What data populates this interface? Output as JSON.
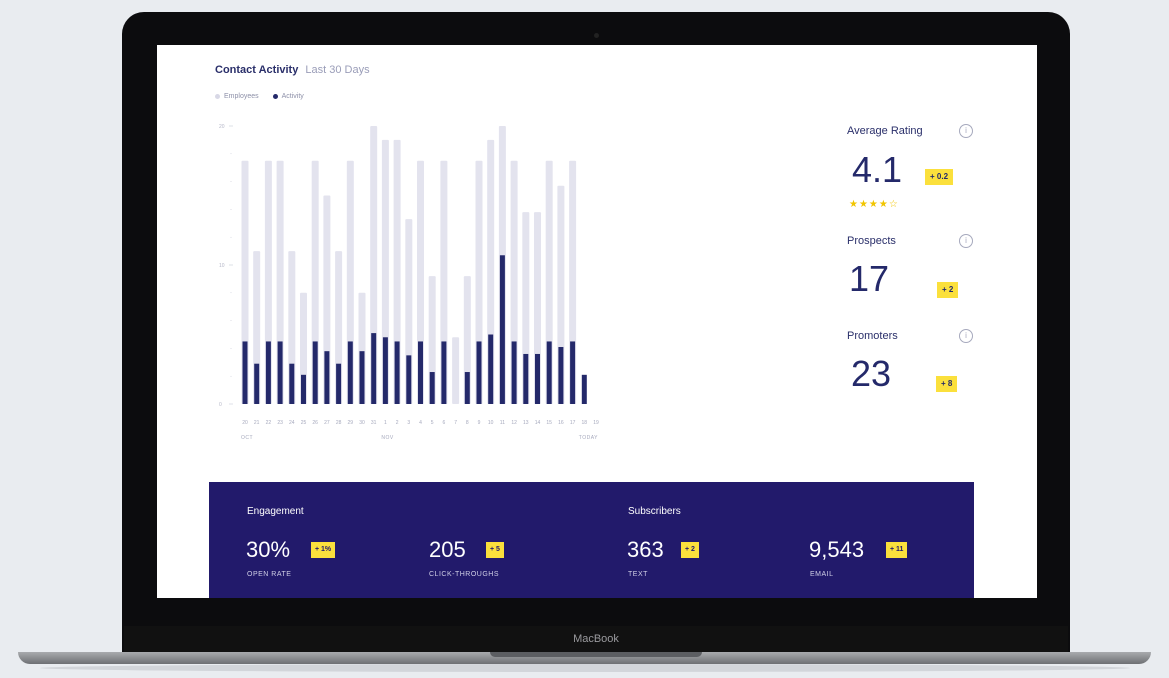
{
  "device": {
    "brand": "MacBook"
  },
  "header": {
    "title": "Contact Activity",
    "subtitle": "Last 30 Days"
  },
  "legend": [
    {
      "label": "Employees",
      "color": "#d8d8e6"
    },
    {
      "label": "Activity",
      "color": "#24296a"
    }
  ],
  "chart_data": {
    "type": "bar",
    "categories": [
      "20",
      "21",
      "22",
      "23",
      "24",
      "25",
      "26",
      "27",
      "28",
      "29",
      "30",
      "31",
      "1",
      "2",
      "3",
      "4",
      "5",
      "6",
      "7",
      "8",
      "9",
      "10",
      "11",
      "12",
      "13",
      "14",
      "15",
      "16",
      "17",
      "18",
      "19"
    ],
    "month_labels": {
      "0": "OCT",
      "12": "NOV",
      "30": "TODAY"
    },
    "y_ticks": [
      "0",
      "10",
      "20"
    ],
    "ylim": [
      0,
      20
    ],
    "series": [
      {
        "name": "Employees",
        "color": "#e3e3ee",
        "values": [
          17.5,
          11,
          17.5,
          17.5,
          11,
          8,
          17.5,
          15,
          11,
          17.5,
          8,
          20,
          19,
          19,
          13.3,
          17.5,
          9.2,
          17.5,
          4.8,
          9.2,
          17.5,
          19,
          20,
          17.5,
          13.8,
          13.8,
          17.5,
          15.7,
          17.5
        ]
      },
      {
        "name": "Activity",
        "color": "#24296a",
        "values": [
          4.5,
          2.9,
          4.5,
          4.5,
          2.9,
          2.1,
          4.5,
          3.8,
          2.9,
          4.5,
          3.8,
          5.1,
          4.8,
          4.5,
          3.5,
          4.5,
          2.3,
          4.5,
          0,
          2.3,
          4.5,
          5,
          10.7,
          4.5,
          3.6,
          3.6,
          4.5,
          4.1,
          4.5,
          2.1
        ]
      }
    ]
  },
  "stats": [
    {
      "label": "Average Rating",
      "value": "4.1",
      "change": "+ 0.2",
      "stars": "★★★★☆"
    },
    {
      "label": "Prospects",
      "value": "17",
      "change": "+ 2"
    },
    {
      "label": "Promoters",
      "value": "23",
      "change": "+ 8"
    }
  ],
  "panel": {
    "engagement_title": "Engagement",
    "subscribers_title": "Subscribers",
    "metrics": [
      {
        "value": "30%",
        "change": "+ 1%",
        "caption": "OPEN RATE"
      },
      {
        "value": "205",
        "change": "+ 5",
        "caption": "CLICK-THROUGHS"
      },
      {
        "value": "363",
        "change": "+ 2",
        "caption": "TEXT"
      },
      {
        "value": "9,543",
        "change": "+ 11",
        "caption": "EMAIL"
      }
    ]
  }
}
